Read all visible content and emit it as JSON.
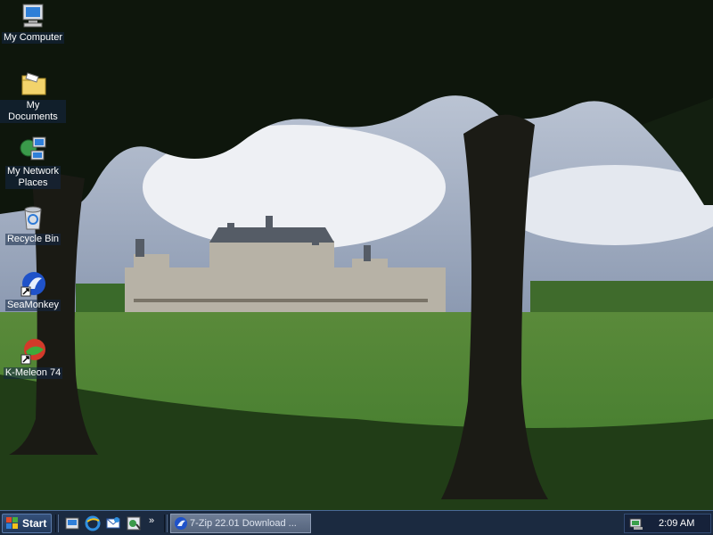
{
  "desktop": {
    "icons": [
      {
        "label": "My Computer",
        "icon": "my-computer-icon"
      },
      {
        "label": "My Documents",
        "icon": "my-documents-icon"
      },
      {
        "label_line1": "My Network",
        "label_line2": "Places",
        "icon": "network-places-icon"
      },
      {
        "label": "Recycle Bin",
        "icon": "recycle-bin-icon"
      },
      {
        "label": "SeaMonkey",
        "icon": "seamonkey-icon"
      },
      {
        "label": "K-Meleon 74",
        "icon": "k-meleon-icon"
      }
    ]
  },
  "taskbar": {
    "start_label": "Start",
    "more_label": "»",
    "active_task": "7-Zip 22.01 Download ...",
    "clock": "2:09 AM"
  },
  "colors": {
    "taskbar_bg": "#1b2a40",
    "icon_label_bg": "#142846"
  }
}
